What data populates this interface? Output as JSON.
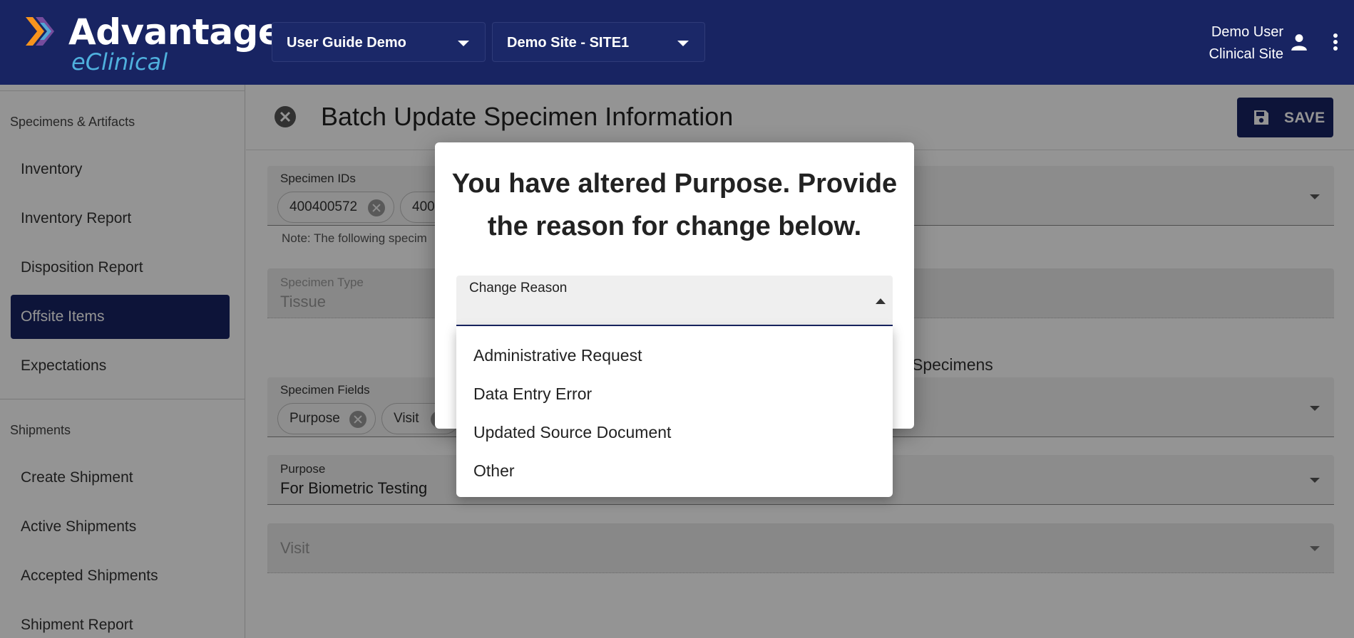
{
  "header": {
    "logo_title": "Advantage",
    "logo_subtitle": "eClinical",
    "study_select": "User Guide Demo",
    "site_select": "Demo Site - SITE1",
    "user_name": "Demo User",
    "user_role": "Clinical Site",
    "icons": [
      "person-icon",
      "more-vert-icon"
    ]
  },
  "sidebar": {
    "sections": [
      {
        "title": "Specimens & Artifacts",
        "items": [
          {
            "label": "Inventory"
          },
          {
            "label": "Inventory Report"
          },
          {
            "label": "Disposition Report"
          },
          {
            "label": "Offsite Items",
            "active": true
          },
          {
            "label": "Expectations"
          }
        ]
      },
      {
        "title": "Shipments",
        "items": [
          {
            "label": "Create Shipment"
          },
          {
            "label": "Active Shipments"
          },
          {
            "label": "Accepted Shipments"
          },
          {
            "label": "Shipment Report"
          }
        ]
      }
    ]
  },
  "main": {
    "title": "Batch Update Specimen Information",
    "save_label": "SAVE",
    "specimen_ids": {
      "label": "Specimen IDs",
      "chips": [
        "400400572",
        "400"
      ]
    },
    "note": "Note: The following specim",
    "specimen_type": {
      "label": "Specimen Type",
      "value": "Tissue"
    },
    "right_text": "Specimens",
    "specimen_fields": {
      "label": "Specimen Fields",
      "chips": [
        "Purpose",
        "Visit"
      ]
    },
    "purpose": {
      "label": "Purpose",
      "value": "For Biometric Testing"
    },
    "visit": {
      "label": "Visit"
    }
  },
  "dialog": {
    "title": "You have altered Purpose. Provide the reason for change below.",
    "select_label": "Change Reason",
    "options": [
      "Administrative Request",
      "Data Entry Error",
      "Updated Source Document",
      "Other"
    ]
  },
  "colors": {
    "brand_navy": "#182462",
    "logo_accent": "#4fb0dd"
  }
}
